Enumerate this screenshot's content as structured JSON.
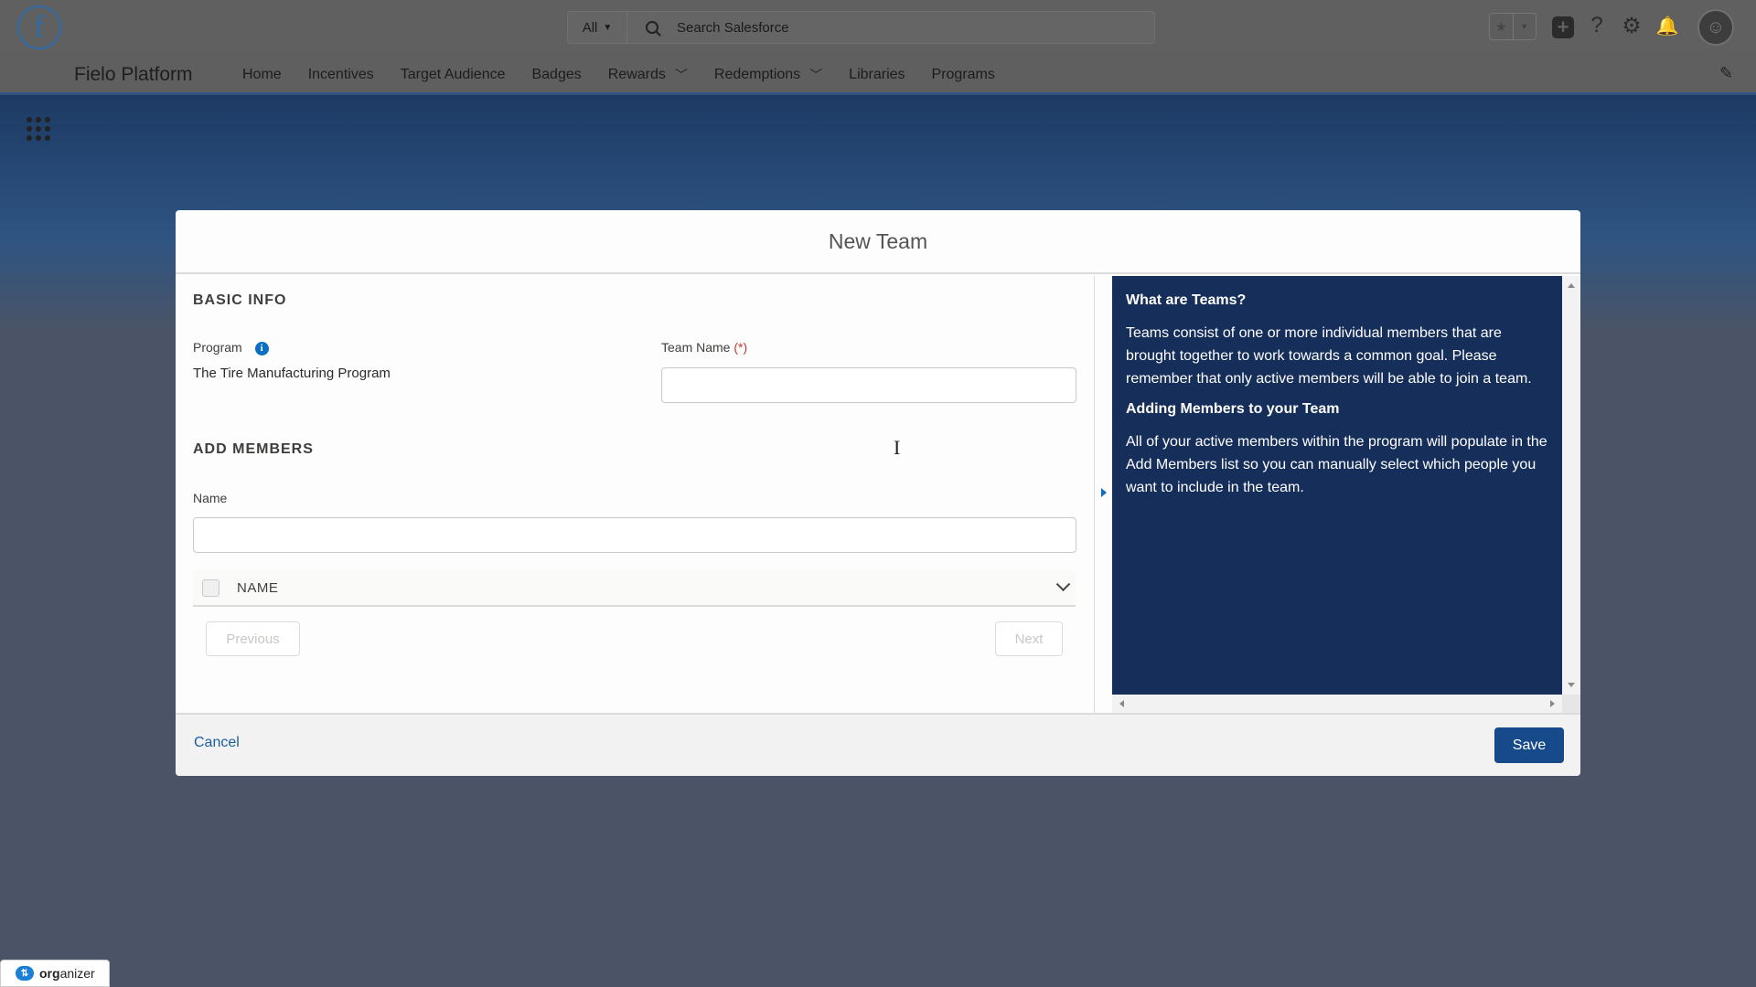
{
  "header": {
    "search_scope": "All",
    "search_placeholder": "Search Salesforce",
    "logo_letter": "f"
  },
  "nav": {
    "app_name": "Fielo Platform",
    "items": [
      {
        "label": "Home",
        "has_menu": false
      },
      {
        "label": "Incentives",
        "has_menu": false
      },
      {
        "label": "Target Audience",
        "has_menu": false
      },
      {
        "label": "Badges",
        "has_menu": false
      },
      {
        "label": "Rewards",
        "has_menu": true
      },
      {
        "label": "Redemptions",
        "has_menu": true
      },
      {
        "label": "Libraries",
        "has_menu": false
      },
      {
        "label": "Programs",
        "has_menu": false
      }
    ]
  },
  "modal": {
    "title": "New Team",
    "basic_info": {
      "section_title": "BASIC INFO",
      "program_label": "Program",
      "program_value": "The Tire Manufacturing Program",
      "team_name_label": "Team Name",
      "team_name_required": "(*)",
      "team_name_value": ""
    },
    "add_members": {
      "section_title": "ADD MEMBERS",
      "name_label": "Name",
      "name_value": "",
      "column_header": "NAME",
      "previous_label": "Previous",
      "next_label": "Next"
    },
    "help": {
      "heading1": "What are Teams?",
      "para1": "Teams consist of one or more individual members that are brought together to work towards a common goal. Please remember that only active members will be able to join a team.",
      "heading2": "Adding Members to your Team",
      "para2": "All of your active members within the program will populate in the Add Members list so you can manually select which people you want to include in the team."
    },
    "footer": {
      "cancel_label": "Cancel",
      "save_label": "Save"
    }
  },
  "organizer": {
    "label_bold": "org",
    "label_rest": "anizer"
  },
  "colors": {
    "brand_blue": "#164a8a",
    "help_panel_bg": "#162e5a",
    "link_blue": "#1b5e9b",
    "required_red": "#c23934"
  }
}
